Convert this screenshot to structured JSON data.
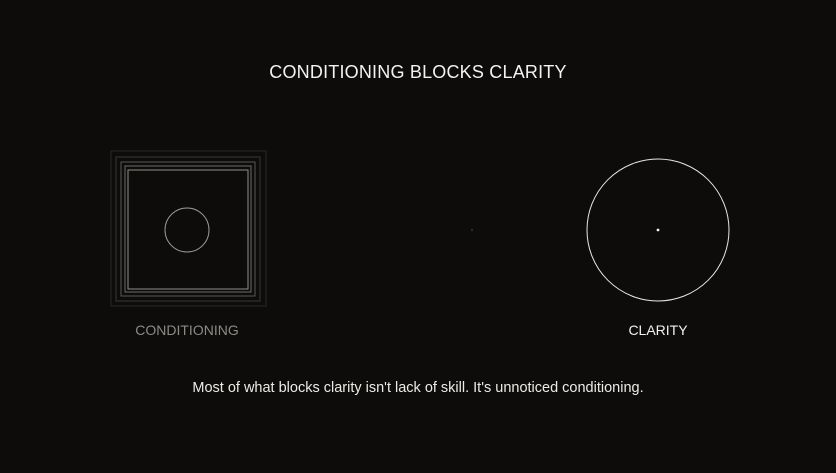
{
  "title": "CONDITIONING BLOCKS CLARITY",
  "left_label": "CONDITIONING",
  "right_label": "CLARITY",
  "caption": "Most of what blocks clarity isn't lack of skill. It's unnoticed conditioning.",
  "colors": {
    "background": "#0d0c0a",
    "text_bright": "#f2f2f0",
    "text_dim": "#8b8a86",
    "line_bright": "#e8e8e4",
    "line_dim": "#6a6864"
  }
}
